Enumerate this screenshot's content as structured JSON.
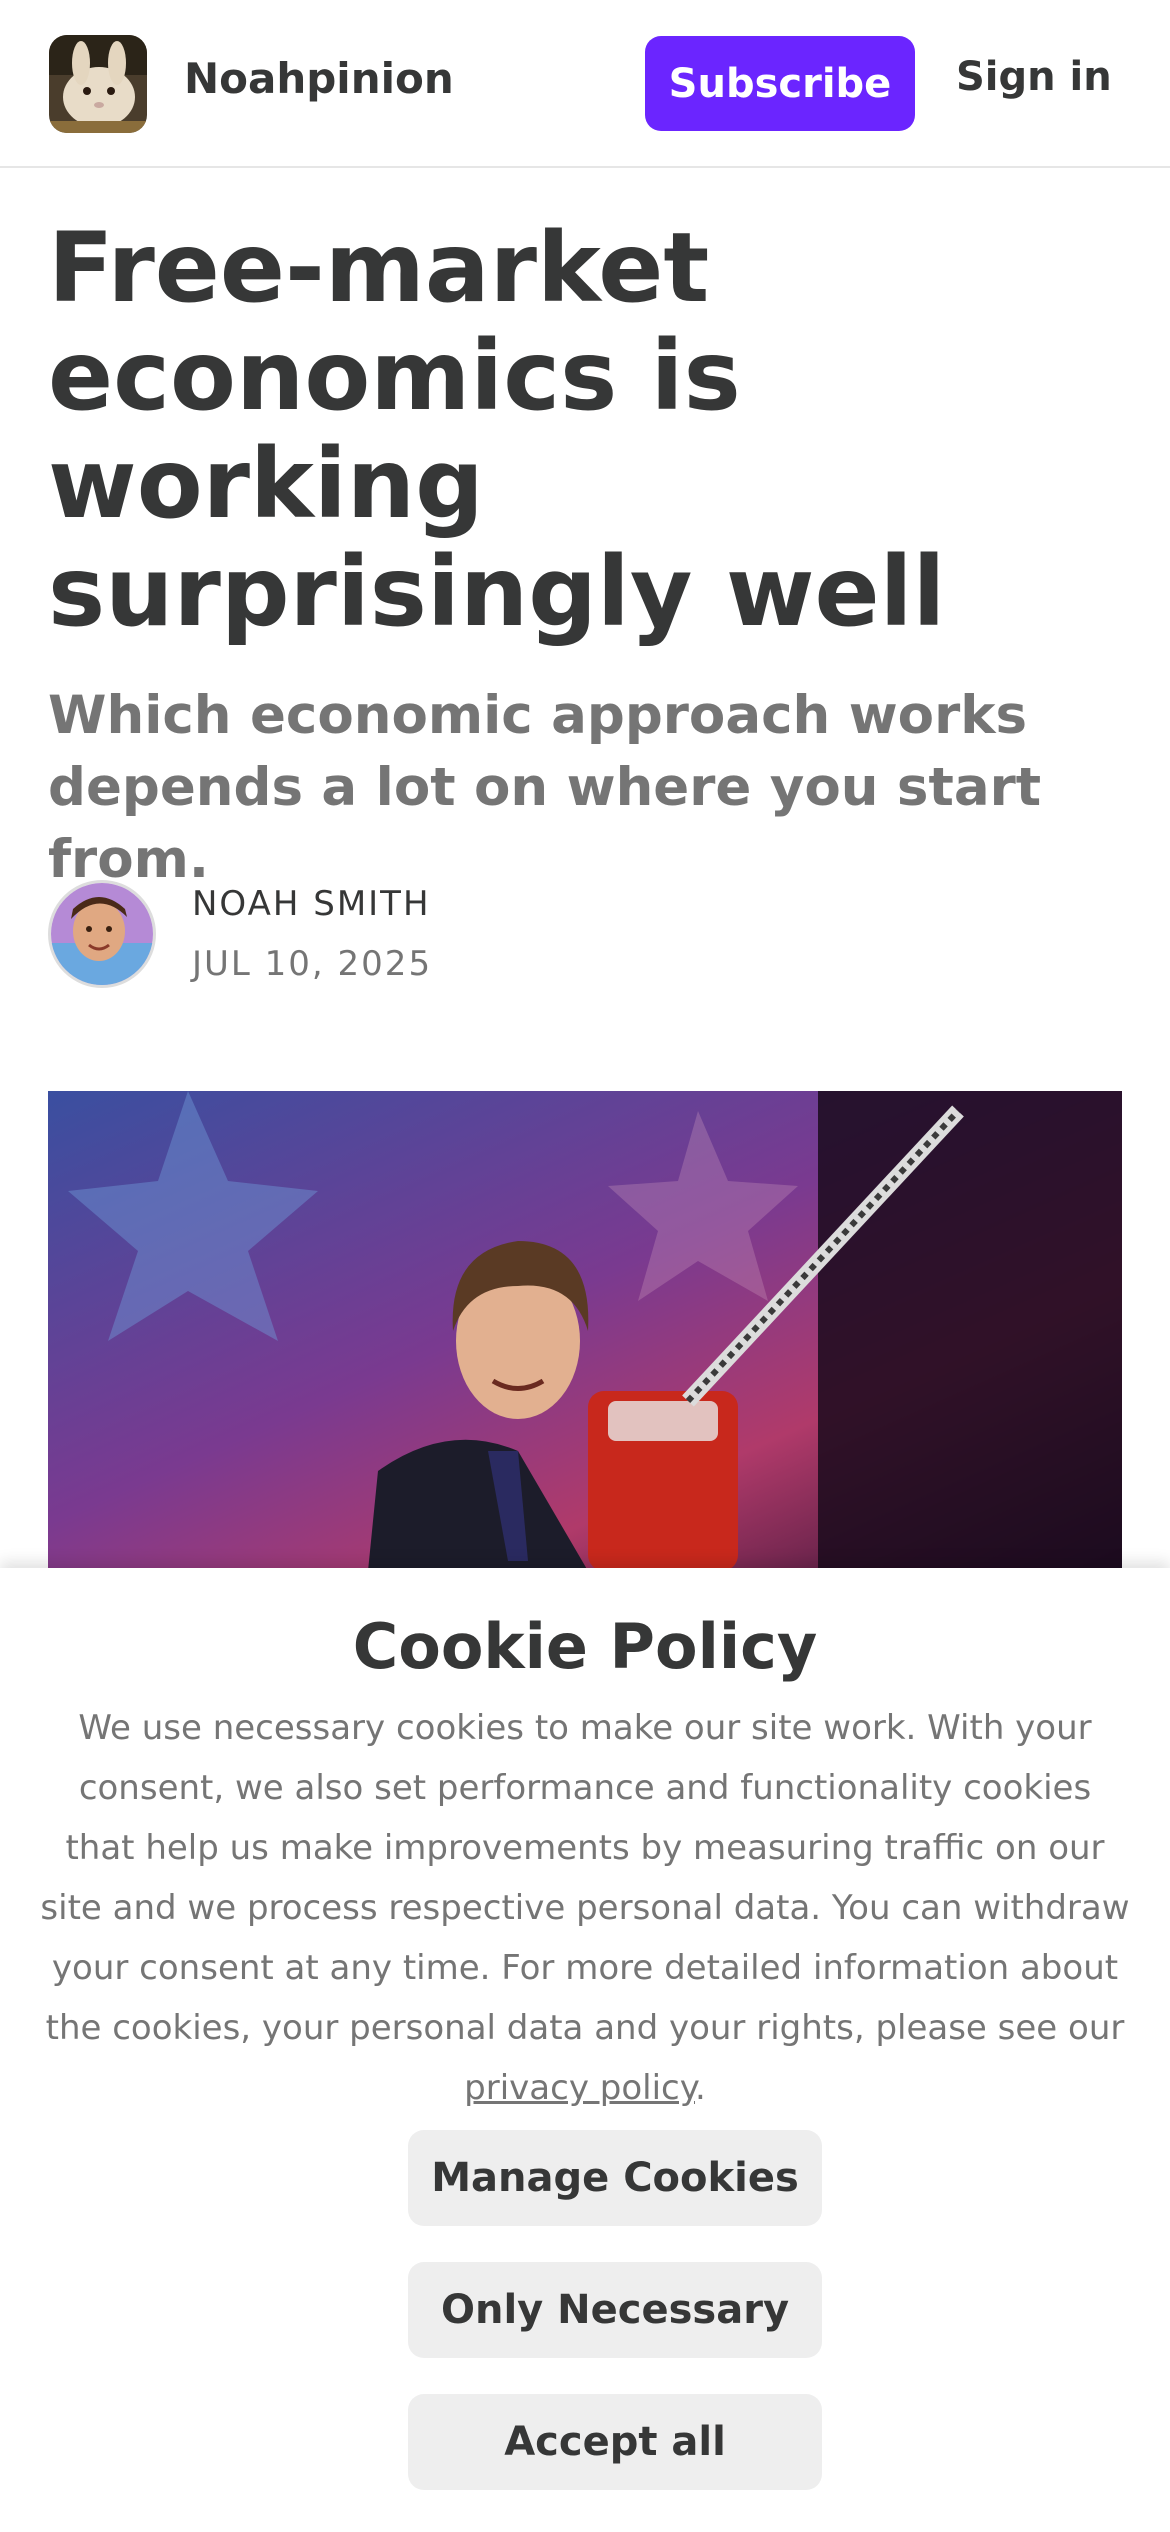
{
  "header": {
    "publication_name": "Noahpinion",
    "subscribe_label": "Subscribe",
    "signin_label": "Sign in"
  },
  "article": {
    "title": "Free-market economics is working surprisingly well",
    "subtitle": "Which economic approach works depends a lot on where you start from.",
    "author": "NOAH SMITH",
    "date": "JUL 10, 2025"
  },
  "cookie_banner": {
    "title": "Cookie Policy",
    "body": "We use necessary cookies to make our site work. With your consent, we also set performance and functionality cookies that help us make improvements by measuring traffic on our site and we process respective personal data. You can withdraw your consent at any time. For more detailed information about the cookies, your personal data and your rights, please see our",
    "link_text": "privacy policy",
    "link_suffix": ".",
    "buttons": {
      "manage": "Manage Cookies",
      "necessary": "Only Necessary",
      "accept": "Accept all"
    }
  },
  "colors": {
    "accent": "#6b25ff",
    "text": "#363737",
    "muted": "#757575",
    "button_bg": "#eeeeee"
  }
}
